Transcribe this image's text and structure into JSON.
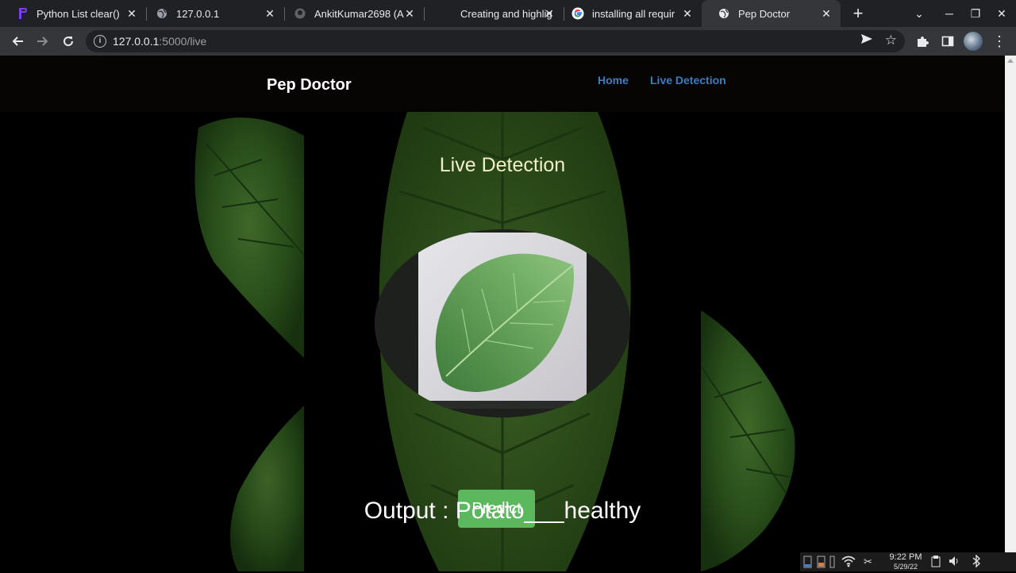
{
  "browser": {
    "tabs": [
      {
        "title": "Python List clear()",
        "icon": "pycharm-icon"
      },
      {
        "title": "127.0.0.1",
        "icon": "globe-icon"
      },
      {
        "title": "AnkitKumar2698 (A",
        "icon": "github-icon"
      },
      {
        "title": "Creating and highlig",
        "icon": "blank-icon"
      },
      {
        "title": "installing all requir",
        "icon": "google-icon"
      },
      {
        "title": "Pep Doctor",
        "icon": "globe-icon",
        "active": true
      }
    ],
    "url_host": "127.0.0.1",
    "url_path": ":5000/live"
  },
  "site": {
    "brand": "Pep Doctor",
    "nav": {
      "home": "Home",
      "live": "Live Detection"
    },
    "heading": "Live Detection",
    "predict_label": "Predict",
    "output_text": "Output : Potato___healthy"
  },
  "taskbar": {
    "time": "9:22 PM",
    "date": "5/29/22"
  },
  "colors": {
    "nav_link": "#3b7ec0",
    "predict_button": "#5cb85c",
    "heading": "#f0f0c8"
  }
}
